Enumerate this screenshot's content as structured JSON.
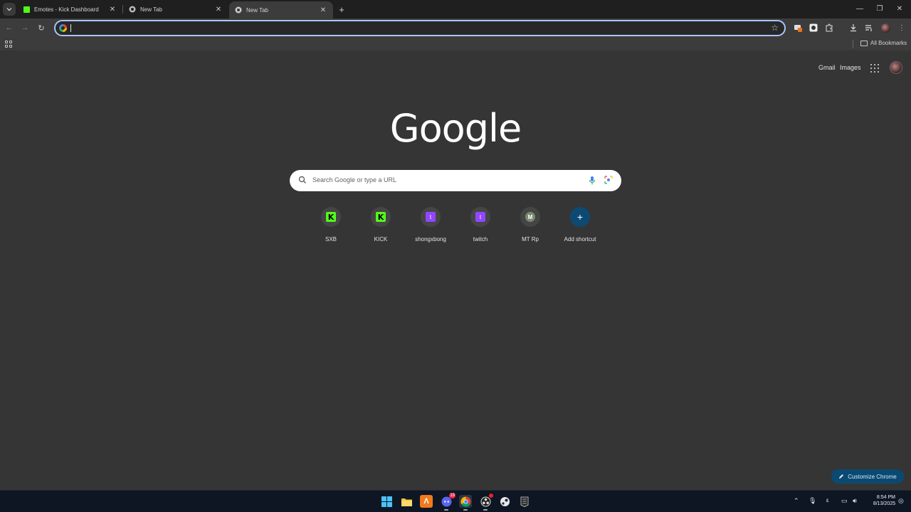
{
  "tabs": [
    {
      "title": "Emotes - Kick Dashboard",
      "favicon": "kick-icon"
    },
    {
      "title": "New Tab",
      "favicon": "chrome-icon"
    },
    {
      "title": "New Tab",
      "favicon": "chrome-icon",
      "active": true
    }
  ],
  "omnibox": {
    "value": ""
  },
  "bookmarks": {
    "all_label": "All Bookmarks"
  },
  "ntp": {
    "gmail_label": "Gmail",
    "images_label": "Images",
    "logo_text": "Google",
    "search_placeholder": "Search Google or type a URL",
    "shortcuts": [
      {
        "label": "SXB",
        "icon": "kick-logo",
        "glyph": "K"
      },
      {
        "label": "KICK",
        "icon": "kick-logo",
        "glyph": "K"
      },
      {
        "label": "shongxbong",
        "icon": "twitch-logo",
        "glyph": "t"
      },
      {
        "label": "twitch",
        "icon": "twitch-logo",
        "glyph": "t"
      },
      {
        "label": "MT Rp",
        "icon": "letter-avatar",
        "glyph": "M"
      },
      {
        "label": "Add shortcut",
        "icon": "plus-icon",
        "glyph": "+"
      }
    ],
    "customize_label": "Customize Chrome"
  },
  "taskbar": {
    "discord_badge": "19",
    "tray_lang": "ε",
    "time": "8:54 PM",
    "date": "8/13/2025"
  },
  "colors": {
    "accent": "#a8c7fa",
    "kick_green": "#53fc18",
    "twitch_purple": "#9146ff",
    "background": "#353535"
  }
}
